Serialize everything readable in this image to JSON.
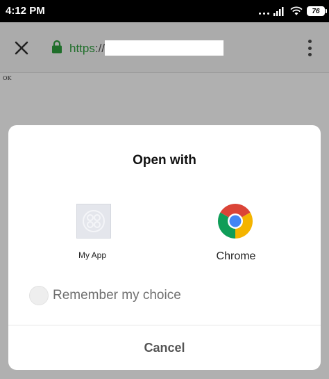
{
  "status_bar": {
    "time": "4:12 PM",
    "battery": "76",
    "icons": [
      "more-dots-icon",
      "signal-icon",
      "wifi-icon",
      "battery-icon"
    ]
  },
  "toolbar": {
    "close_icon": "close-icon",
    "lock_icon": "lock-icon",
    "url_scheme": "https",
    "url_separator": "://",
    "menu_icon": "overflow-menu-icon",
    "secure_color": "#1f6e2a"
  },
  "page": {
    "body_text": "OK"
  },
  "dialog": {
    "title": "Open with",
    "apps": [
      {
        "label": "My App",
        "icon": "my-app-icon"
      },
      {
        "label": "Chrome",
        "icon": "chrome-icon"
      }
    ],
    "remember_label": "Remember my choice",
    "cancel_label": "Cancel"
  }
}
